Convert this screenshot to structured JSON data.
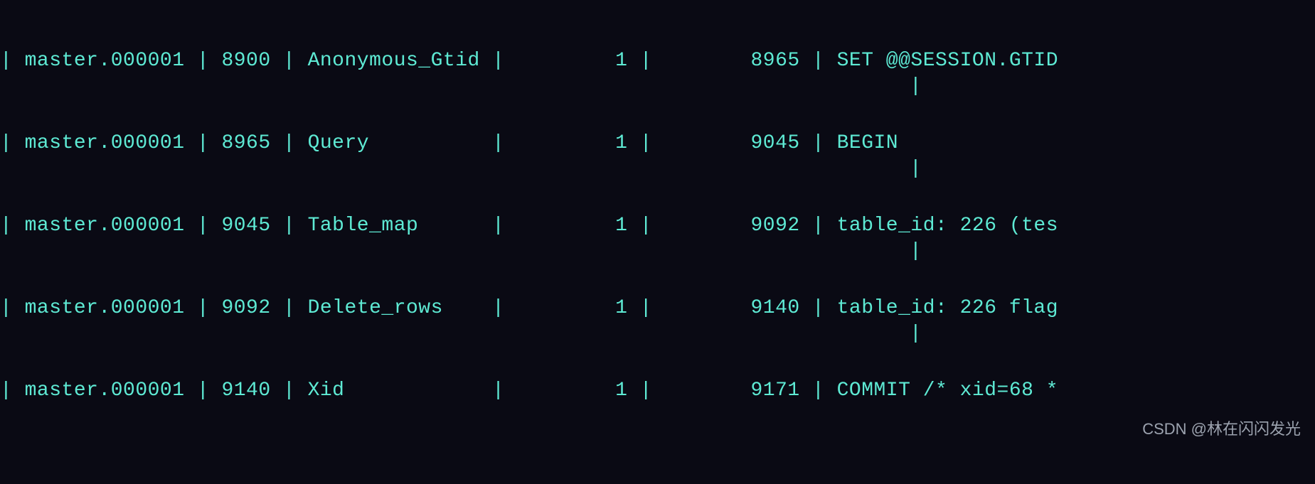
{
  "terminal": {
    "pipe": "|",
    "rows": [
      {
        "log_name": "master.000001",
        "pos": "8900",
        "event_type": "Anonymous_Gtid",
        "server_id": "1",
        "end_log_pos": "8965",
        "info": "SET @@SESSION.GTID"
      },
      {
        "log_name": "master.000001",
        "pos": "8965",
        "event_type": "Query",
        "server_id": "1",
        "end_log_pos": "9045",
        "info": "BEGIN"
      },
      {
        "log_name": "master.000001",
        "pos": "9045",
        "event_type": "Table_map",
        "server_id": "1",
        "end_log_pos": "9092",
        "info": "table_id: 226 (tes"
      },
      {
        "log_name": "master.000001",
        "pos": "9092",
        "event_type": "Delete_rows",
        "server_id": "1",
        "end_log_pos": "9140",
        "info": "table_id: 226 flag"
      },
      {
        "log_name": "master.000001",
        "pos": "9140",
        "event_type": "Xid",
        "server_id": "1",
        "end_log_pos": "9171",
        "info": "COMMIT /* xid=68 *"
      }
    ]
  },
  "watermark": "CSDN @林在闪闪发光"
}
